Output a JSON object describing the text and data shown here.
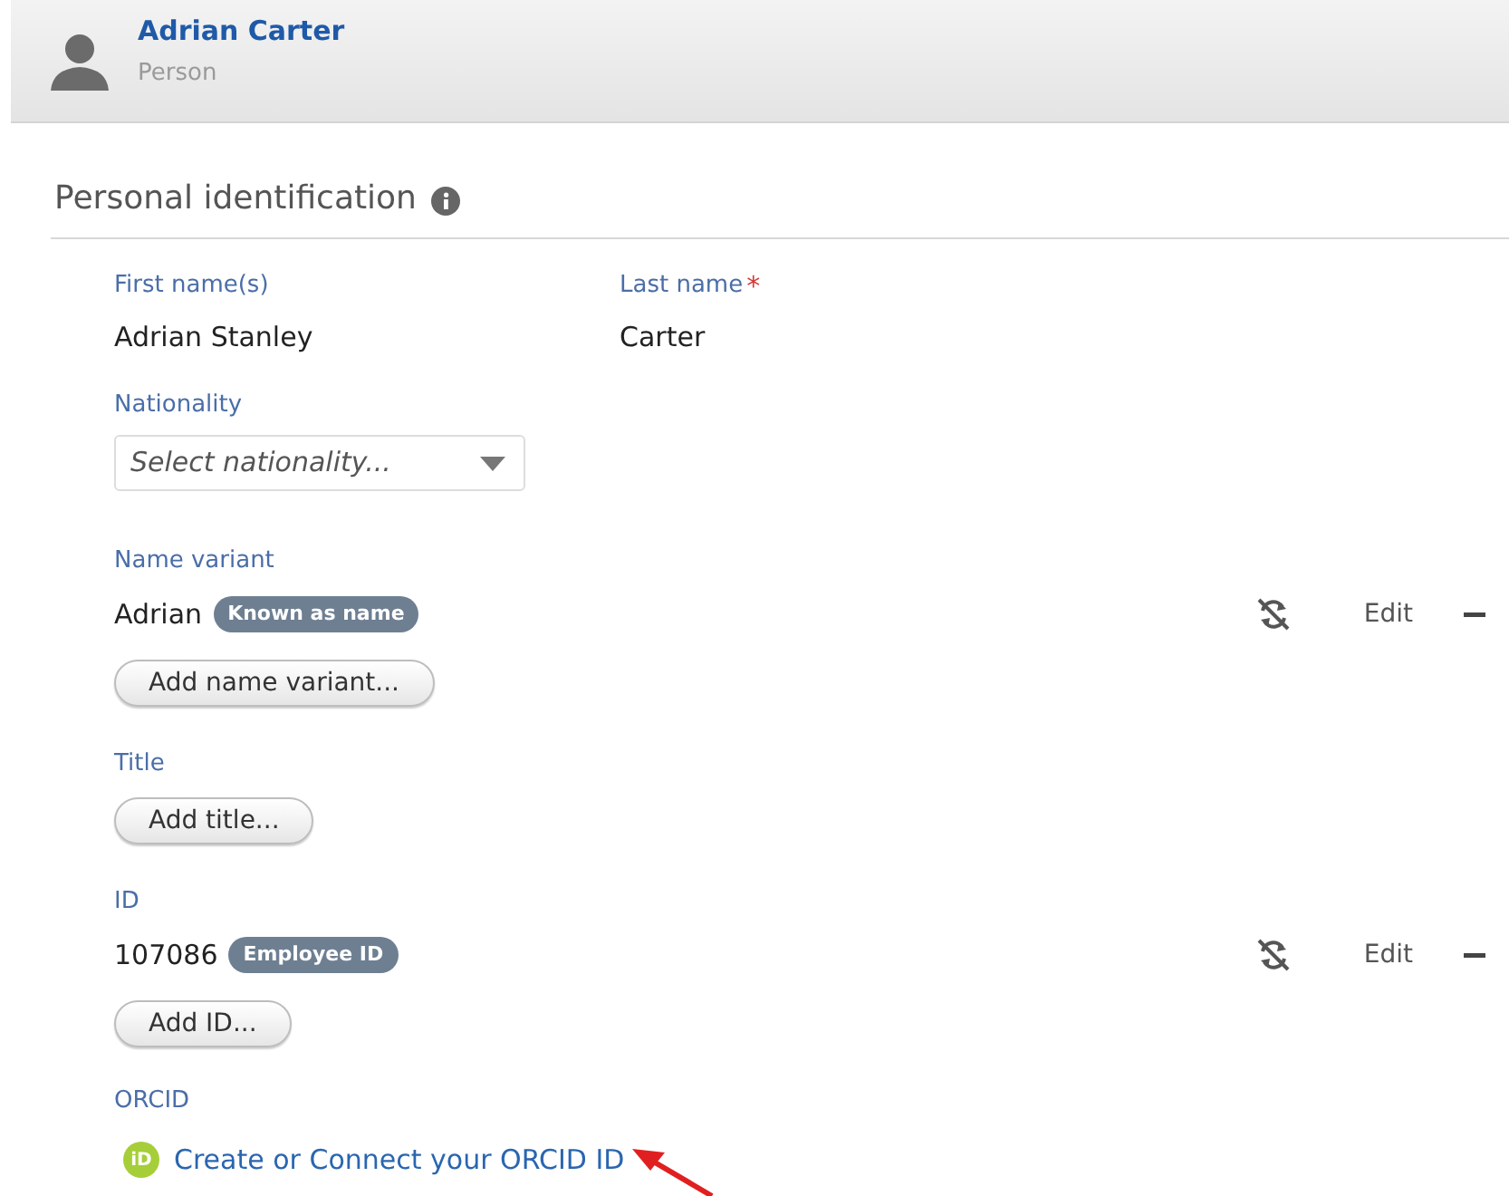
{
  "header": {
    "name": "Adrian Carter",
    "type": "Person"
  },
  "section": {
    "title": "Personal identification"
  },
  "fields": [
    {
      "label": "First name(s)",
      "value": "Adrian Stanley"
    },
    {
      "label": "Last name",
      "required_mark": "*",
      "value": "Carter"
    }
  ],
  "nationality": {
    "label": "Nationality",
    "placeholder": "Select nationality..."
  },
  "groups": [
    {
      "label": "Name variant",
      "items": [
        {
          "value": "Adrian",
          "tag": "Known as name",
          "action": "Edit"
        }
      ],
      "button": "Add name variant..."
    },
    {
      "label": "Title",
      "button": "Add title..."
    },
    {
      "label": "ID",
      "items": [
        {
          "value": "107086",
          "tag": "Employee ID",
          "action": "Edit"
        }
      ],
      "button": "Add ID..."
    }
  ],
  "orcid": {
    "label": "ORCID",
    "icon_text": "iD",
    "link": "Create or Connect your ORCID ID"
  }
}
